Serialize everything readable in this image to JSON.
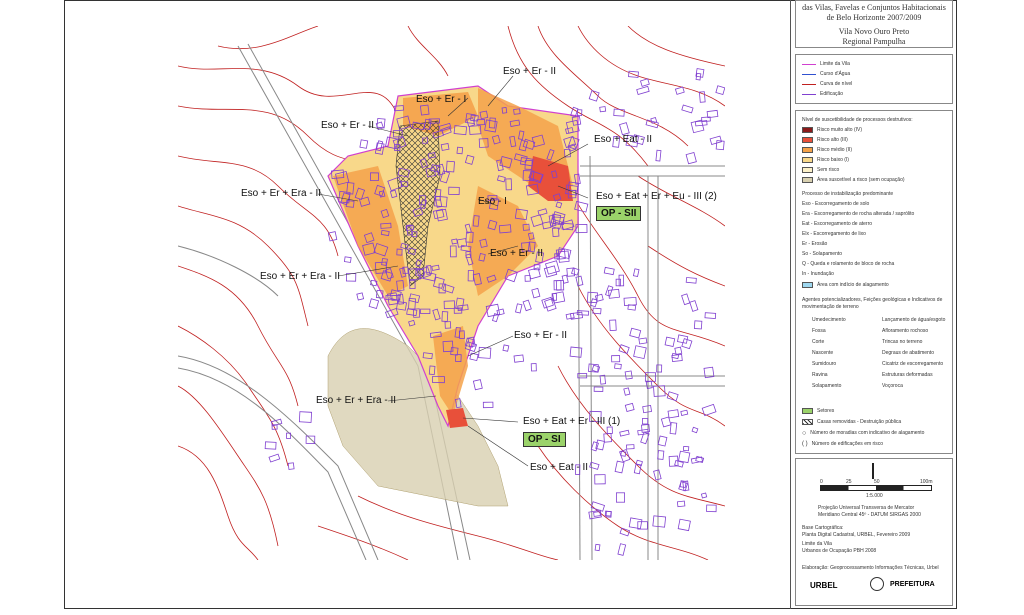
{
  "header": {
    "title_line1": "das Vilas, Favelas e Conjuntos Habitacionais",
    "title_line2": "de Belo Horizonte 2007/2009",
    "place": "Vila Novo Ouro Preto",
    "regional": "Regional Pampulha"
  },
  "legend_lines": [
    {
      "label": "Limite da Vila",
      "color": "#d040d0"
    },
    {
      "label": "Curso d'Água",
      "color": "#3050d0"
    },
    {
      "label": "Curva de nível",
      "color": "#c02020"
    },
    {
      "label": "Edificação",
      "color": "#8040d0"
    }
  ],
  "risk_title": "Nível de suscetibilidade de processos destrutivos:",
  "risk_levels": [
    {
      "label": "Risco muito alto (IV)",
      "color": "#8b1a1a"
    },
    {
      "label": "Risco alto (III)",
      "color": "#e8503a"
    },
    {
      "label": "Risco médio (II)",
      "color": "#f4a24a"
    },
    {
      "label": "Risco baixo (I)",
      "color": "#f8d88a"
    },
    {
      "label": "Sem risco",
      "color": "#fbf0c8"
    },
    {
      "label": "Área suscetível a risco (sem ocupação)",
      "color": "#d8d0b0"
    }
  ],
  "process_title": "Processo de instabilização predominante",
  "processes": [
    "Eso - Escorregamento de solo",
    "Era - Escorregamento de rocha alterada / saprólito",
    "Eat - Escorregamento de aterro",
    "Elx - Escorregamento de lixo",
    "Er - Erosão",
    "So - Solapamento",
    "Q - Queda e rolamento de bloco de rocha",
    "In - Inundação",
    "Área com indício de alagamento"
  ],
  "agents_title": "Agentes potencializadores, Feições geológicas e Indicativos de movimentação de terreno",
  "agents": [
    {
      "left": "Umedecimento",
      "right": "Lançamento de água/esgoto"
    },
    {
      "left": "Fossa",
      "right": "Afloramento rochoso"
    },
    {
      "left": "Corte",
      "right": "Trincas no terreno"
    },
    {
      "left": "Nascente",
      "right": "Degraus de abatimento"
    },
    {
      "left": "Sumidouro",
      "right": "Cicatriz de escorregamento"
    },
    {
      "left": "Ravina",
      "right": "Estruturas deformadas"
    },
    {
      "left": "Solapamento",
      "right": "Voçoroca"
    }
  ],
  "extra_legend": [
    "Setores",
    "Casas removidas - Destruição pública",
    "Número de moradias com indicativo de alagamento",
    "Número de edificações em risco"
  ],
  "scale": {
    "ticks": [
      "0",
      "25",
      "50",
      "100m"
    ],
    "ratio": "1:5.000"
  },
  "credits": [
    "Projeção Universal Transversa de Mercator",
    "Meridiano Central 45º - DATUM SIRGAS 2000",
    "Base Cartográfica:",
    "Planta Digital Cadastral, URBEL, Fevereiro 2009",
    "Limite da Vila",
    "Urbanos de Ocupação PBH 2008",
    "Elaboração: Geoprocessamento Informações Técnicas, Urbel"
  ],
  "logos": [
    "URBEL",
    "PREFEITURA"
  ],
  "map_labels": [
    "Eso + Er - II",
    "Eso + Er - I",
    "Eso + Er - II",
    "Eso + Eat - II",
    "Eso + Er + Era - II",
    "Eso + Eat + Er + Eu - III (2)",
    "Eso - I",
    "Eso + Er - II",
    "Eso + Er + Era - II",
    "Eso + Er - II",
    "Eso + Er + Era - II",
    "Eso + Eat + Er - III (1)",
    "Eso + Eat - II"
  ],
  "op_labels": [
    "OP - SII",
    "OP - SI"
  ],
  "colors": {
    "contour": "#c02020",
    "building": "#8040d0",
    "road": "#888888",
    "boundary": "#d040d0"
  }
}
